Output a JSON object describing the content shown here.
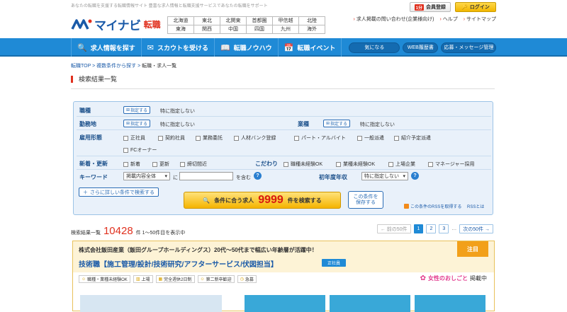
{
  "header": {
    "tagline": "あなたの転職を支援する転職情報サイト 豊富な求人情報と転職支援サービスであなたの転職をサポート",
    "logo_text": "マイナビ",
    "logo_sub": "転職",
    "areas": [
      "北海道",
      "東北",
      "北関東",
      "首都圏",
      "甲信越",
      "北陸",
      "東海",
      "関西",
      "中国",
      "四国",
      "九州",
      "海外"
    ],
    "member_badge": "1分",
    "member_label": "会員登録",
    "login_label": "ログイン",
    "links": [
      "求人掲載の問い合わせ(企業様向け)",
      "ヘルプ",
      "サイトマップ"
    ]
  },
  "nav": {
    "items": [
      {
        "icon": "search-icon",
        "label": "求人情報を探す"
      },
      {
        "icon": "scout-icon",
        "label": "スカウトを受ける"
      },
      {
        "icon": "book-icon",
        "label": "転職ノウハウ"
      },
      {
        "icon": "calendar-icon",
        "label": "転職イベント"
      }
    ],
    "pills": [
      "気になる",
      "WEB履歴書",
      "応募・メッセージ管理"
    ]
  },
  "breadcrumb": {
    "items": [
      "転職TOP",
      "複数条件から探す"
    ],
    "separator": ">",
    "current": "転職・求人一覧"
  },
  "page_title": "検索結果一覧",
  "form": {
    "shokushu_label": "職種",
    "kinmuchi_label": "勤務地",
    "gyoshu_label": "業種",
    "specify_label": "指定する",
    "unspecified": "特に指定しない",
    "koyo_label": "雇用形態",
    "koyo_options": [
      "正社員",
      "契約社員",
      "業務委託",
      "人材バンク登録",
      "パート・アルバイト",
      "一般派遣",
      "紹介予定派遣",
      "FCオーナー"
    ],
    "shinchaku_label": "新着・更新",
    "shinchaku_options": [
      "新着",
      "更新",
      "締切間近"
    ],
    "kodawari_label": "こだわり",
    "kodawari_options": [
      "職種未経験OK",
      "業種未経験OK",
      "上場企業",
      "マネージャー採用"
    ],
    "keyword_label": "キーワード",
    "keyword_scope": "掲載内容全体",
    "keyword_ni": "に",
    "keyword_fukumu": "を含む",
    "keyword_value": "",
    "nenshu_label": "初年度年収",
    "nenshu_value": "特に指定しない",
    "more_label": "さらに詳しい条件で検索する",
    "search_prefix": "条件に合う求人",
    "search_count": "9999",
    "search_suffix": "件を検索する",
    "save_line1": "この条件を",
    "save_line2": "保存する",
    "rss_link": "この条件のRSSを取得する",
    "rss_about": "RSSとは"
  },
  "results": {
    "prefix": "検索結果一覧",
    "count": "10428",
    "suffix": "件 1～50件目を表示中",
    "pager_prev": "← 前の50件",
    "pages": [
      "1",
      "2",
      "3"
    ],
    "pager_more": "…",
    "pager_next": "次の50件 →"
  },
  "card": {
    "company": "株式会社飯田産業（飯田グループホールディングス）20代～50代まで幅広い年齢層が活躍中！",
    "title": "技術職【施工管理/設計/技術研究/アフターサービス/伏図担当】",
    "emp_type": "正社員",
    "attention": "注目",
    "tags": [
      "職種・業種未経験OK",
      "上場",
      "完全週休2日制",
      "第二新卒歓迎",
      "急募"
    ],
    "josei_label": "女性のおしごと",
    "josei_suffix": "掲載中"
  },
  "colors": {
    "brand_blue": "#1f8ad6",
    "accent_red": "#e0301e",
    "search_yellow": "#f5b400"
  }
}
